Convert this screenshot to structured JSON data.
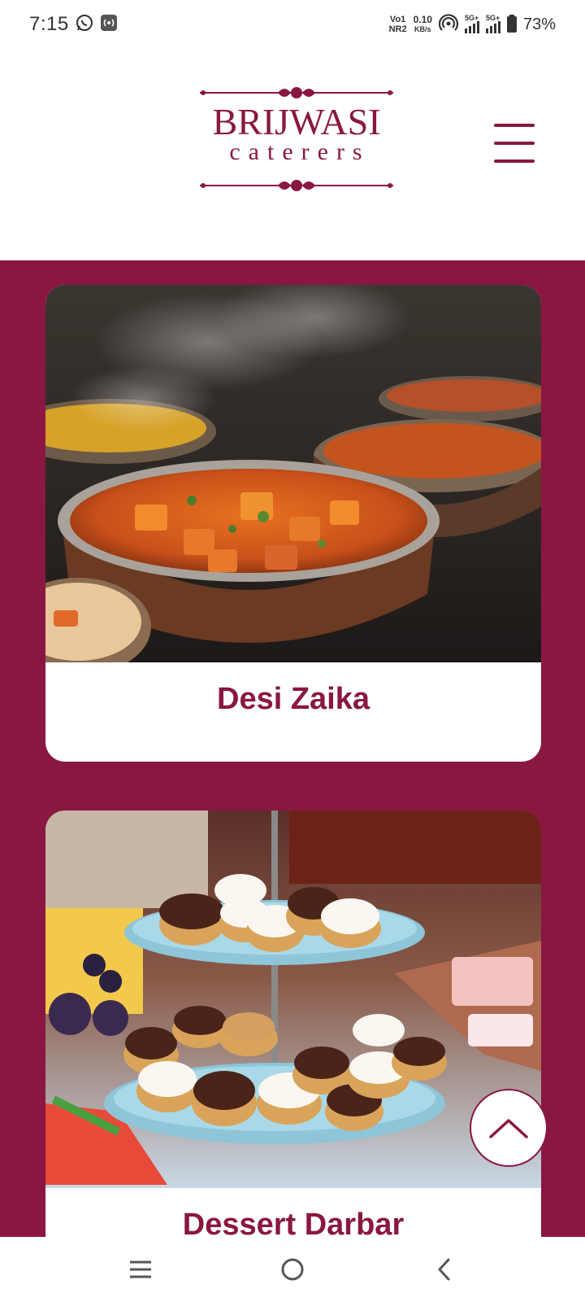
{
  "status_bar": {
    "time": "7:15",
    "left_icons": [
      "whatsapp-icon",
      "hotspot-icon"
    ],
    "vo_line1": "Vo1",
    "vo_line2": "NR2",
    "speed_value": "0.10",
    "speed_unit": "KB/s",
    "signal1_label": "5G+",
    "signal2_label": "5G+",
    "battery": "73%"
  },
  "header": {
    "logo_brand": "BRIJWASI",
    "logo_sub": "caterers",
    "menu_icon": "hamburger-menu-icon"
  },
  "cards": [
    {
      "title": "Desi Zaika",
      "image": "indian-curry-buffet-image"
    },
    {
      "title": "Dessert Darbar",
      "image": "dessert-platter-image"
    }
  ],
  "scroll_top_icon": "chevron-up-icon",
  "nav": {
    "recents_icon": "recents-icon",
    "home_icon": "home-icon",
    "back_icon": "back-icon"
  },
  "colors": {
    "brand": "#8a1742",
    "background": "#ffffff"
  }
}
